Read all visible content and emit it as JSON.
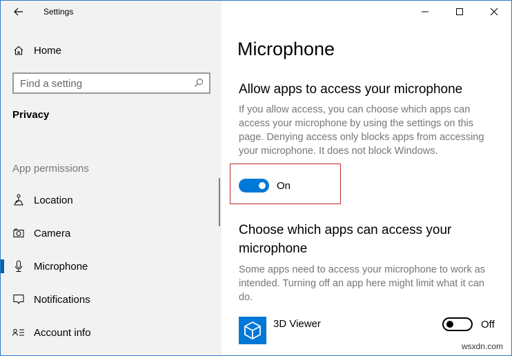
{
  "window": {
    "title": "Settings",
    "controls": {
      "minimize": "minimize-icon",
      "maximize": "maximize-icon",
      "close": "close-icon"
    }
  },
  "sidebar": {
    "back_icon": "back-arrow-icon",
    "home": {
      "label": "Home",
      "icon": "home-icon"
    },
    "search": {
      "placeholder": "Find a setting",
      "value": "",
      "icon": "search-icon"
    },
    "section": "Privacy",
    "group_label": "App permissions",
    "items": [
      {
        "label": "Location",
        "icon": "location-icon",
        "active": false
      },
      {
        "label": "Camera",
        "icon": "camera-icon",
        "active": false
      },
      {
        "label": "Microphone",
        "icon": "microphone-icon",
        "active": true
      },
      {
        "label": "Notifications",
        "icon": "notifications-icon",
        "active": false
      },
      {
        "label": "Account info",
        "icon": "account-info-icon",
        "active": false
      }
    ]
  },
  "main": {
    "title": "Microphone",
    "allow_section": {
      "heading": "Allow apps to access your microphone",
      "description": "If you allow access, you can choose which apps can access your microphone by using the settings on this page. Denying access only blocks apps from accessing your microphone. It does not block Windows.",
      "toggle": {
        "state": "on",
        "label": "On"
      }
    },
    "choose_section": {
      "heading": "Choose which apps can access your microphone",
      "description": "Some apps need to access your microphone to work as intended. Turning off an app here might limit what it can do.",
      "apps": [
        {
          "name": "3D Viewer",
          "icon": "3d-viewer-icon",
          "toggle": {
            "state": "off",
            "label": "Off"
          }
        }
      ]
    }
  },
  "colors": {
    "accent": "#0078d7",
    "active_indicator": "#0063b1",
    "highlight_box": "#c4282f",
    "window_border": "#2b79c2",
    "sidebar_bg": "#f2f2f2",
    "secondary_text": "#767676"
  },
  "watermark": "wsxdn.com"
}
